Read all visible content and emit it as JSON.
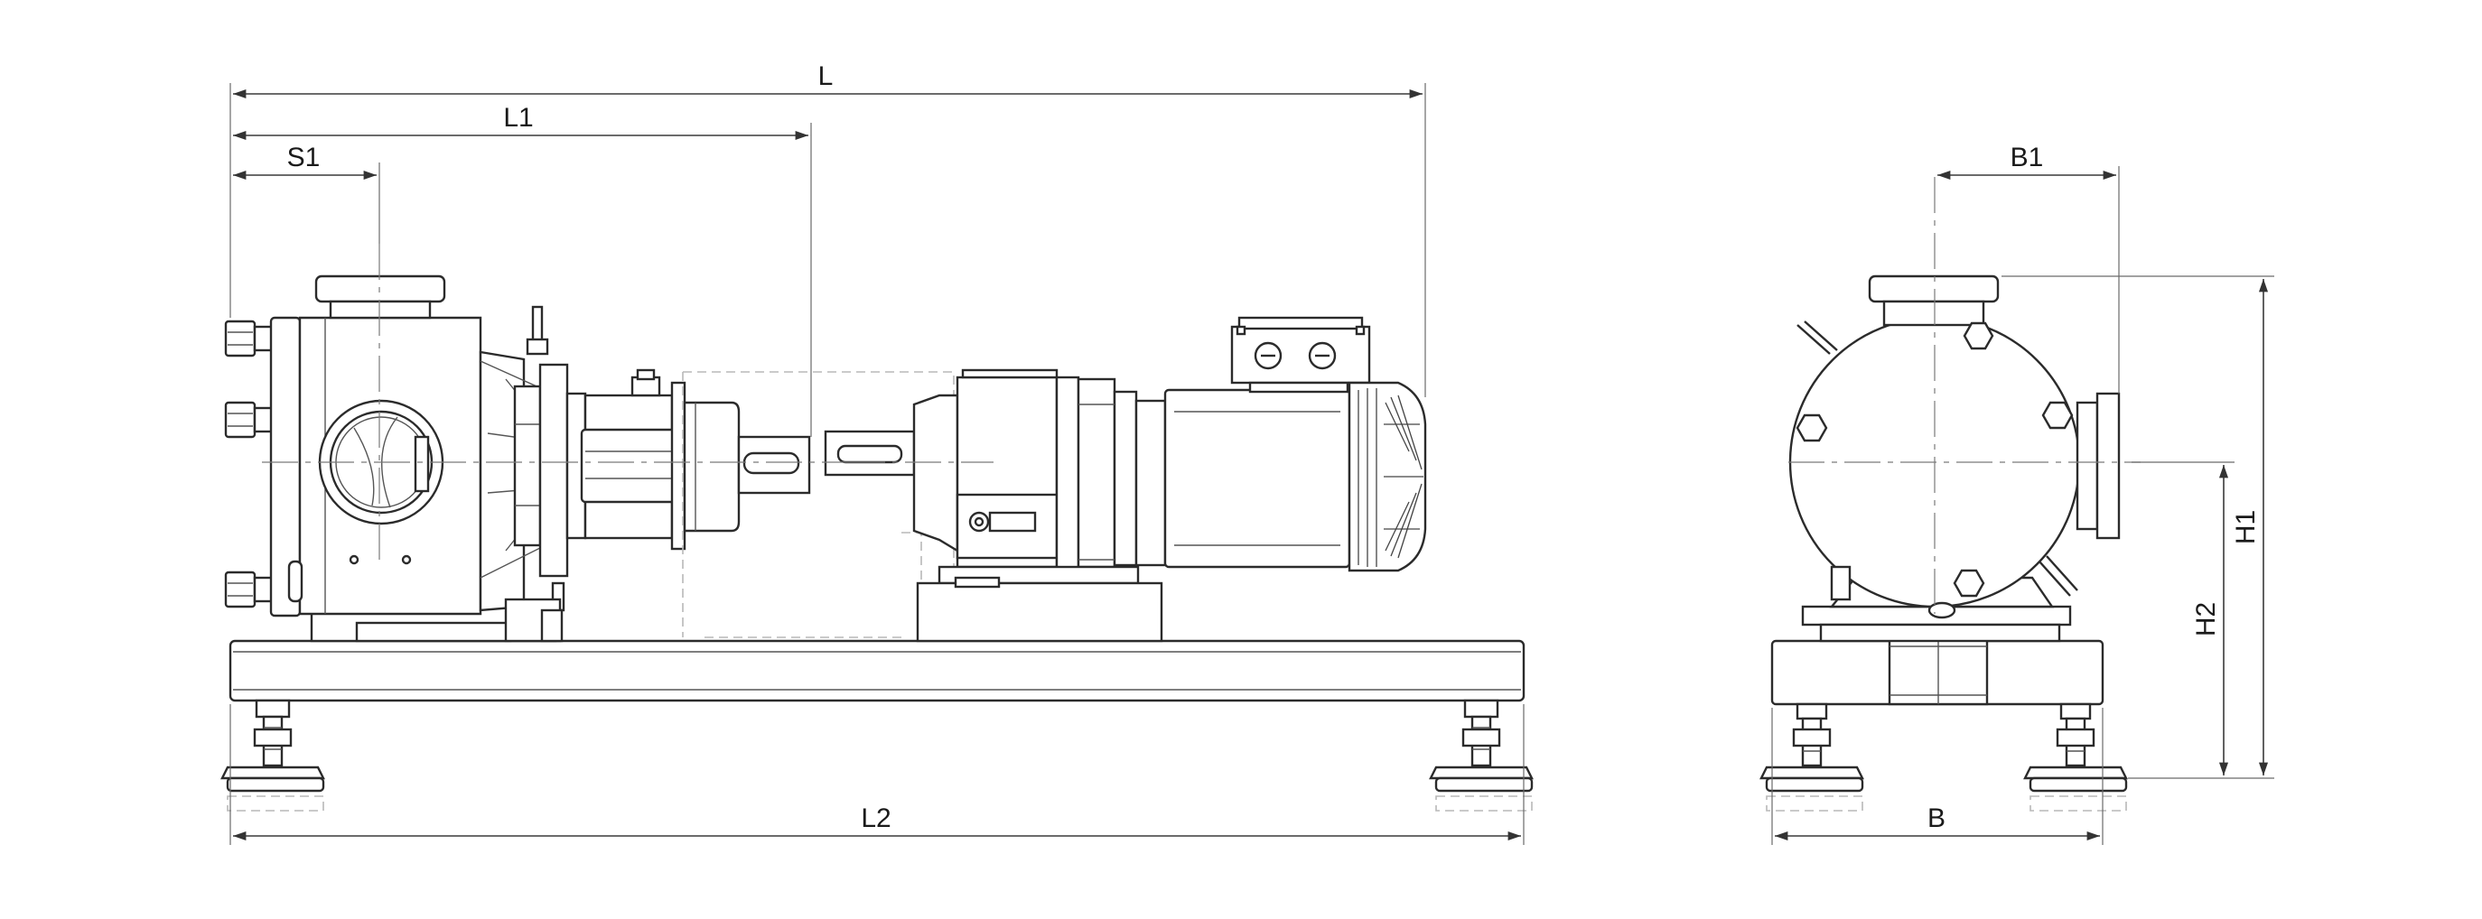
{
  "drawing": {
    "labels": {
      "L": "L",
      "L1": "L1",
      "S1": "S1",
      "L2": "L2",
      "B1": "B1",
      "B": "B",
      "H1": "H1",
      "H2": "H2"
    }
  }
}
